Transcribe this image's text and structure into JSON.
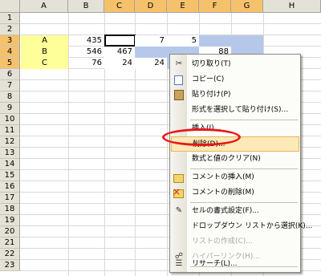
{
  "columns": [
    "A",
    "B",
    "C",
    "D",
    "E",
    "F",
    "G",
    "H"
  ],
  "rows": [
    "1",
    "2",
    "3",
    "4",
    "5",
    "6",
    "7",
    "8",
    "9",
    "10",
    "11",
    "12",
    "13",
    "14",
    "15",
    "16",
    "17",
    "18",
    "19",
    "20",
    "21",
    "22",
    "23"
  ],
  "cells": {
    "a3": "A",
    "b3": "435",
    "c3": "",
    "d3": "7",
    "e3": "5",
    "a4": "B",
    "b4": "546",
    "c4": "467",
    "f4": "88",
    "a5": "C",
    "b5": "76",
    "c5": "24",
    "d5": "24"
  },
  "context_menu": {
    "items": [
      {
        "label": "切り取り(T)",
        "icon": "scissors-icon",
        "enabled": true
      },
      {
        "label": "コピー(C)",
        "icon": "copy-icon",
        "enabled": true
      },
      {
        "label": "貼り付け(P)",
        "icon": "paste-icon",
        "enabled": true
      },
      {
        "label": "形式を選択して貼り付け(S)...",
        "icon": "",
        "enabled": true
      },
      {
        "label": "挿入(I)...",
        "icon": "",
        "enabled": true
      },
      {
        "label": "削除(D)...",
        "icon": "",
        "enabled": true,
        "highlighted": true
      },
      {
        "label": "数式と値のクリア(N)",
        "icon": "",
        "enabled": true
      },
      {
        "label": "コメントの挿入(M)",
        "icon": "comment-icon",
        "enabled": true
      },
      {
        "label": "コメントの削除(M)",
        "icon": "delete-comment-icon",
        "enabled": true
      },
      {
        "label": "セルの書式設定(F)...",
        "icon": "format-cells-icon",
        "enabled": true
      },
      {
        "label": "ドロップダウン リストから選択(K)...",
        "icon": "",
        "enabled": true
      },
      {
        "label": "リストの作成(C)...",
        "icon": "",
        "enabled": false
      },
      {
        "label": "ハイパーリンク(H)...",
        "icon": "hyperlink-icon",
        "enabled": false
      },
      {
        "label": "リサーチ(L)...",
        "icon": "research-icon",
        "enabled": true
      }
    ]
  },
  "colors": {
    "header_bg": "#e4e1d6",
    "header_selected": "#f5c26b",
    "selection_blue": "#b6c8ea",
    "cell_yellow": "#ffff99",
    "menu_highlight": "#fbe9b7",
    "annotation_circle": "#e81818"
  }
}
